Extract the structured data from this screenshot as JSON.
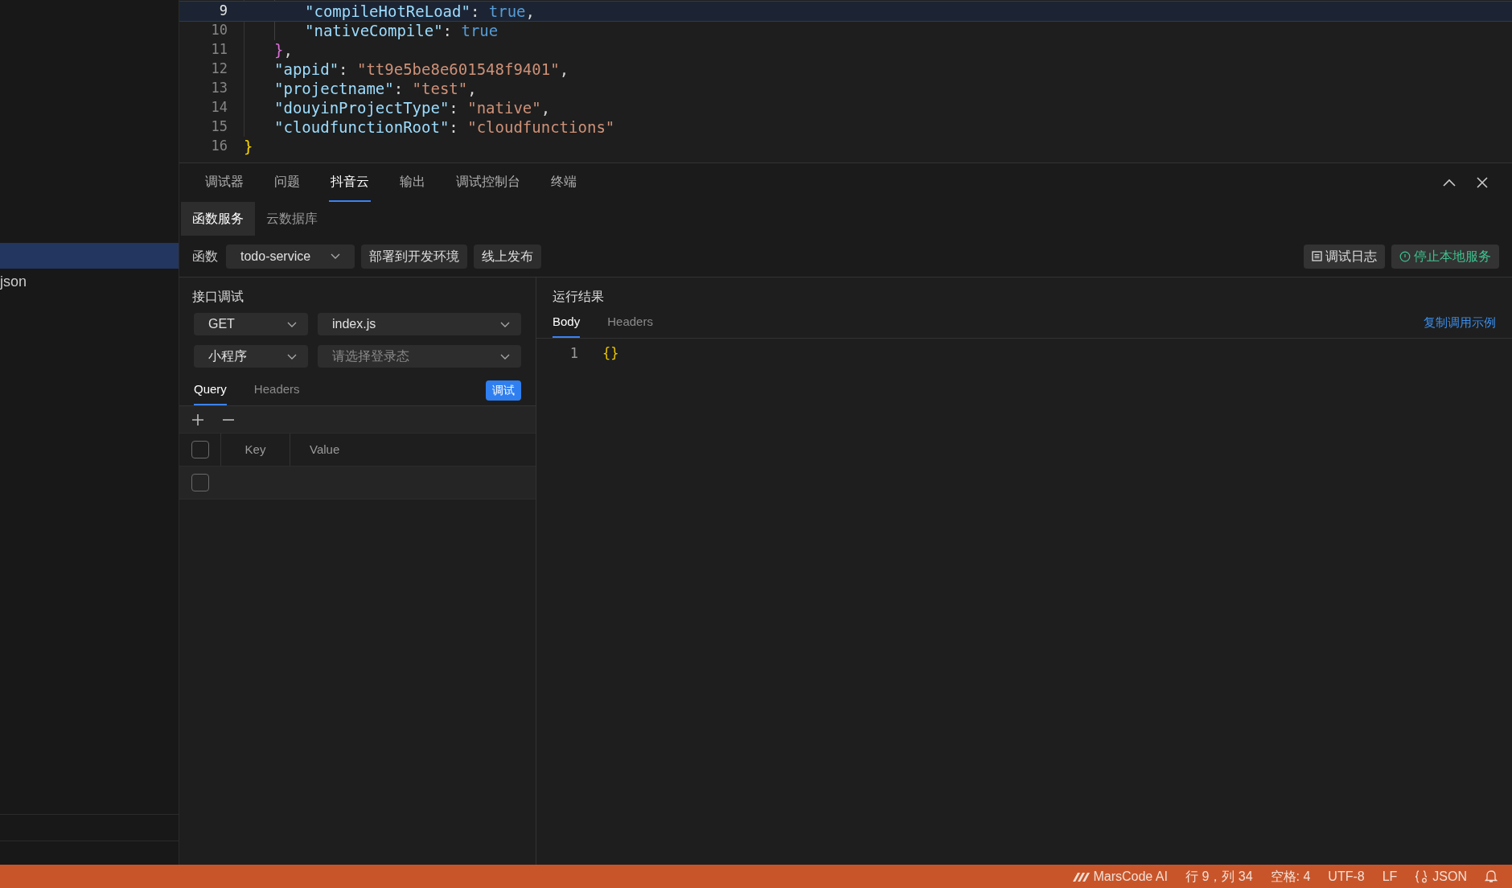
{
  "sidebar": {
    "items": [
      {
        "label": "json",
        "selected": false
      }
    ]
  },
  "editor": {
    "lines": [
      {
        "number": "9",
        "current": true,
        "kind": "inner",
        "tokens": [
          {
            "kind": "key",
            "text": "\"compileHotReLoad\""
          },
          {
            "kind": "punct",
            "text": ": "
          },
          {
            "kind": "bool",
            "text": "true"
          },
          {
            "kind": "punct",
            "text": ","
          }
        ]
      },
      {
        "number": "10",
        "current": false,
        "kind": "inner",
        "tokens": [
          {
            "kind": "key",
            "text": "\"nativeCompile\""
          },
          {
            "kind": "punct",
            "text": ": "
          },
          {
            "kind": "bool",
            "text": "true"
          }
        ]
      },
      {
        "number": "11",
        "current": false,
        "kind": "member",
        "tokens": [
          {
            "kind": "bracket",
            "text": "}"
          },
          {
            "kind": "punct",
            "text": ","
          }
        ]
      },
      {
        "number": "12",
        "current": false,
        "kind": "member",
        "tokens": [
          {
            "kind": "key",
            "text": "\"appid\""
          },
          {
            "kind": "punct",
            "text": ": "
          },
          {
            "kind": "string",
            "text": "\"tt9e5be8e601548f9401\""
          },
          {
            "kind": "punct",
            "text": ","
          }
        ]
      },
      {
        "number": "13",
        "current": false,
        "kind": "member",
        "tokens": [
          {
            "kind": "key",
            "text": "\"projectname\""
          },
          {
            "kind": "punct",
            "text": ": "
          },
          {
            "kind": "string",
            "text": "\"test\""
          },
          {
            "kind": "punct",
            "text": ","
          }
        ]
      },
      {
        "number": "14",
        "current": false,
        "kind": "member",
        "tokens": [
          {
            "kind": "key",
            "text": "\"douyinProjectType\""
          },
          {
            "kind": "punct",
            "text": ": "
          },
          {
            "kind": "string",
            "text": "\"native\""
          },
          {
            "kind": "punct",
            "text": ","
          }
        ]
      },
      {
        "number": "15",
        "current": false,
        "kind": "member",
        "tokens": [
          {
            "kind": "key",
            "text": "\"cloudfunctionRoot\""
          },
          {
            "kind": "punct",
            "text": ": "
          },
          {
            "kind": "string",
            "text": "\"cloudfunctions\""
          }
        ]
      },
      {
        "number": "16",
        "current": false,
        "kind": "root",
        "tokens": [
          {
            "kind": "rootbracket",
            "text": "}"
          }
        ]
      }
    ]
  },
  "panel": {
    "tabs": [
      {
        "label": "调试器",
        "selected": false
      },
      {
        "label": "问题",
        "selected": false
      },
      {
        "label": "抖音云",
        "selected": true
      },
      {
        "label": "输出",
        "selected": false
      },
      {
        "label": "调试控制台",
        "selected": false
      },
      {
        "label": "终端",
        "selected": false
      }
    ],
    "subtabs": [
      {
        "label": "函数服务",
        "selected": true
      },
      {
        "label": "云数据库",
        "selected": false
      }
    ],
    "toolbar": {
      "function_label": "函数",
      "function_select": "todo-service",
      "buttons": [
        "部署到开发环境",
        "线上发布"
      ],
      "right_buttons": [
        {
          "kind": "log",
          "label": "调试日志"
        },
        {
          "kind": "stop",
          "label": "停止本地服务"
        }
      ]
    },
    "request": {
      "title": "接口调试",
      "method": "GET",
      "file": "index.js",
      "client": "小程序",
      "login_state": {
        "placeholder": "请选择登录态"
      },
      "tabs": [
        {
          "label": "Query",
          "selected": true
        },
        {
          "label": "Headers",
          "selected": false
        }
      ],
      "run_button": "调试",
      "table": {
        "header_checked": false,
        "columns": [
          "Key",
          "Value"
        ],
        "rows": [
          {
            "checked": false
          }
        ]
      }
    },
    "result": {
      "title": "运行结果",
      "tabs": [
        {
          "label": "Body",
          "selected": true
        },
        {
          "label": "Headers",
          "selected": false
        }
      ],
      "copy_link": "复制调用示例",
      "lines": [
        {
          "number": "1",
          "text": "{}"
        }
      ]
    }
  },
  "status_bar": {
    "items": [
      {
        "kind": "ai",
        "text": "MarsCode AI"
      },
      {
        "kind": "text",
        "text": "行 9，列 34"
      },
      {
        "kind": "text",
        "text": "空格: 4"
      },
      {
        "kind": "text",
        "text": "UTF-8"
      },
      {
        "kind": "text",
        "text": "LF"
      },
      {
        "kind": "language",
        "text": "JSON"
      },
      {
        "kind": "bell"
      }
    ]
  }
}
